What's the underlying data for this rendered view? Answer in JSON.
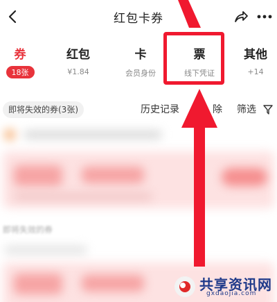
{
  "header": {
    "title": "红包卡券"
  },
  "tabs": [
    {
      "label": "券",
      "badge": "18张",
      "active": true
    },
    {
      "label": "红包",
      "sub": "¥1.84"
    },
    {
      "label": "卡",
      "sub": "会员身份"
    },
    {
      "label": "票",
      "sub": "线下凭证",
      "highlighted": true
    },
    {
      "label": "其他",
      "sub": "+14"
    }
  ],
  "filter_bar": {
    "expiring_chip": "即将失效的券(3张)",
    "history": "历史记录",
    "delete": "除",
    "filter": "筛选"
  },
  "content": {
    "section_label": "即将失效的券"
  },
  "watermark": {
    "text": "共享资讯网",
    "url": "gxdaojia.com"
  },
  "colors": {
    "accent": "#e8333b",
    "highlight": "#f0192f",
    "watermark_blue": "#1f3a8a"
  }
}
